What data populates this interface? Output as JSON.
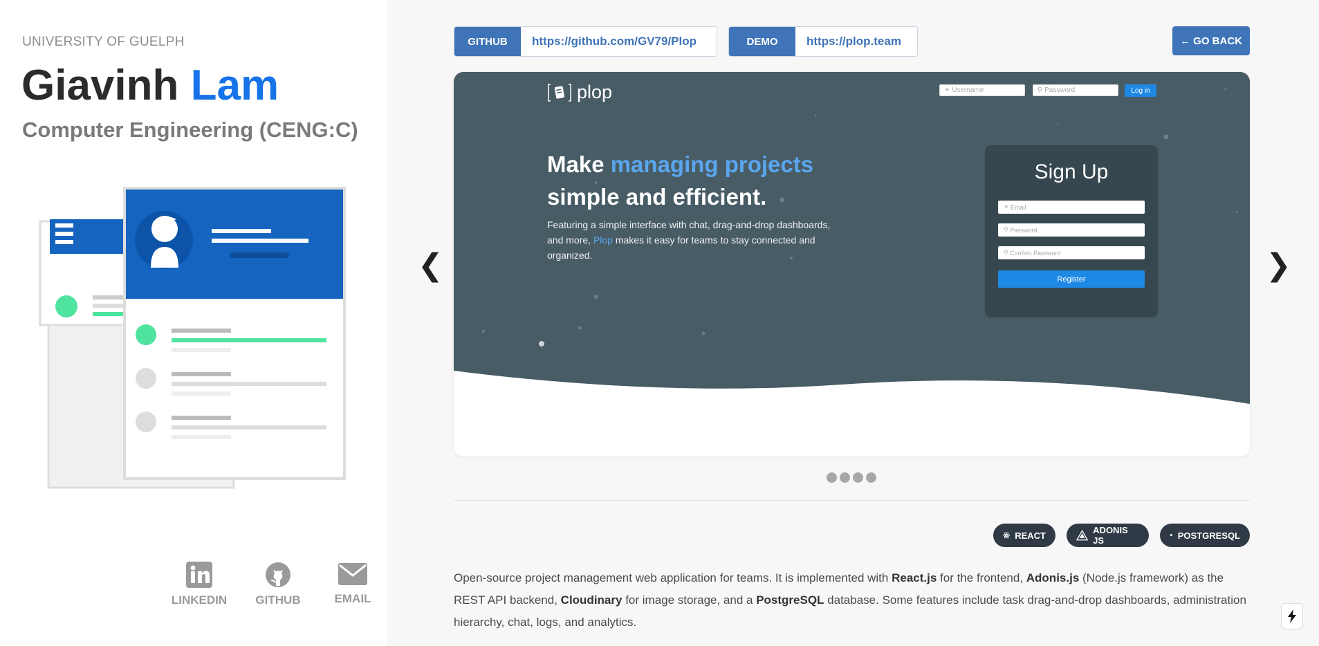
{
  "profile": {
    "university": "UNIVERSITY OF GUELPH",
    "first_name": "Giavinh",
    "last_name": "Lam",
    "program": "Computer Engineering (CENG:C)"
  },
  "social": [
    {
      "label": "LINKEDIN",
      "icon": "linkedin-icon"
    },
    {
      "label": "GITHUB",
      "icon": "github-icon"
    },
    {
      "label": "EMAIL",
      "icon": "email-icon"
    }
  ],
  "links": {
    "github_tag": "GITHUB",
    "github_url": "https://github.com/GV79/Plop",
    "demo_tag": "DEMO",
    "demo_url": "https://plop.team",
    "go_back": "← GO BACK"
  },
  "slide": {
    "logo_text": "plop",
    "username_placeholder": "Username",
    "password_placeholder": "Password",
    "login_label": "Log in",
    "headline_pre": "Make ",
    "headline_highlight": "managing projects",
    "headline_line2": "simple and efficient.",
    "sub_pre": "Featuring a simple interface with chat, drag-and-drop dashboards, and more, ",
    "sub_highlight": "Plop",
    "sub_post": " makes it easy for teams to stay connected and organized.",
    "signup_title": "Sign Up",
    "email_placeholder": "Email",
    "password2_placeholder": "Password",
    "confirm_placeholder": "Confirm Password",
    "register_label": "Register"
  },
  "carousel": {
    "prev_label": "❮",
    "next_label": "❯",
    "slide_count": 4
  },
  "tech": [
    {
      "label": "REACT",
      "icon": "react-icon"
    },
    {
      "label": "ADONIS JS",
      "icon": "adonis-icon"
    },
    {
      "label": "POSTGRESQL",
      "icon": "postgresql-icon"
    }
  ],
  "description": {
    "p1": "Open-source project management web application for teams. It is implemented with ",
    "b1": "React.js",
    "p2": " for the frontend, ",
    "b2": "Adonis.js",
    "p3": " (Node.js framework) as the REST API backend, ",
    "b3": "Cloudinary",
    "p4": " for image storage, and a ",
    "b4": "PostgreSQL",
    "p5": " database. Some features include task drag-and-drop dashboards, administration hierarchy, chat, logs, and analytics."
  },
  "colors": {
    "accent": "#3f74b8",
    "name_highlight": "#1673e8",
    "slide_bg": "#485c66",
    "badge_bg": "#2f3a46"
  }
}
